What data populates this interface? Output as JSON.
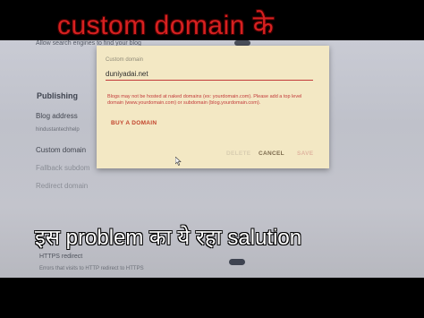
{
  "background_settings": {
    "top_text": "Allow search engines to find your blog",
    "publishing_heading": "Publishing",
    "blog_address_label": "Blog address",
    "blog_address_value": "hindustantechhelp",
    "custom_domain_label": "Custom domain",
    "fallback_subdomain_label": "Fallback subdom",
    "redirect_domain_label": "Redirect domain",
    "https_redirect_label": "HTTPS redirect",
    "https_redirect_desc": "Errors that visits to HTTP redirect to HTTPS"
  },
  "dialog": {
    "field_label": "Custom domain",
    "field_value": "duniyadai.net",
    "error_text": "Blogs may not be hosted at naked domains (ex: yourdomain.com). Please add a top level domain (www.yourdomain.com) or subdomain (blog.yourdomain.com).",
    "buy_domain_label": "BUY A DOMAIN",
    "delete_label": "DELETE",
    "cancel_label": "CANCEL",
    "save_label": "SAVE"
  },
  "overlay": {
    "top_caption": "custom domain के",
    "bottom_caption": "इस problem का ये रहा salution"
  },
  "colors": {
    "top_caption": "#d62020",
    "bottom_caption": "#ffffff",
    "dialog_bg": "#f3e8c4",
    "error_red": "#c23a3a"
  }
}
